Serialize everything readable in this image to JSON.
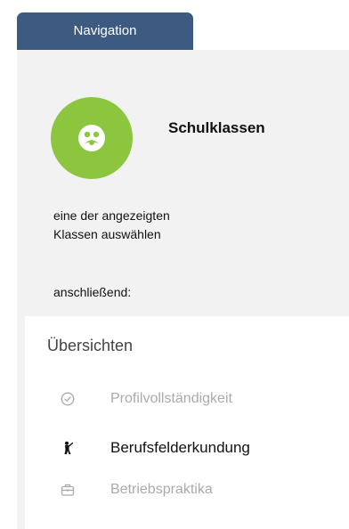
{
  "nav_tab": {
    "label": "Navigation"
  },
  "header": {
    "title": "Schulklassen"
  },
  "instructions": {
    "line1": "eine der angezeigten",
    "line2": "Klassen auswählen",
    "then": "anschließend:"
  },
  "menu": {
    "title": "Übersichten",
    "items": [
      {
        "label": "Profilvollständigkeit",
        "icon": "check-circle-icon",
        "state": "disabled"
      },
      {
        "label": "Berufsfelderkundung",
        "icon": "worker-icon",
        "state": "active"
      },
      {
        "label": "Betriebspraktika",
        "icon": "briefcase-icon",
        "state": "disabled"
      }
    ]
  },
  "colors": {
    "nav_tab_bg": "#3d5a80",
    "avatar_bg": "#8cc63f",
    "panel_bg": "#f2f2f2",
    "disabled_text": "#aaaaaa"
  }
}
